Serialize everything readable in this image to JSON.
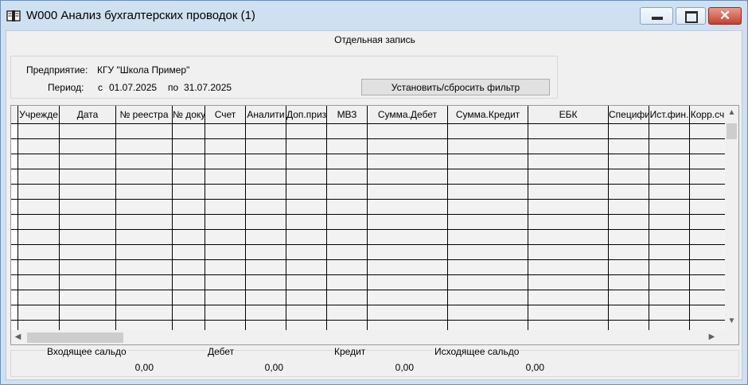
{
  "window": {
    "title": "W000 Анализ бухгалтерских проводок (1)",
    "accent": "#cfe0f1",
    "close_color": "#c7402b",
    "icons": {
      "app": "ledger-book-icon",
      "minimize": "minimize-icon",
      "maximize": "maximize-icon",
      "close": "close-icon"
    }
  },
  "heading": "Отдельная запись",
  "info": {
    "enterprise_label": "Предприятие:",
    "enterprise_value": "КГУ \"Школа Пример\"",
    "period_label": "Период:",
    "from_prefix": "с",
    "date_from": "01.07.2025",
    "to_prefix": "по",
    "date_to": "31.07.2025",
    "filter_button": "Установить/сбросить фильтр"
  },
  "grid": {
    "columns": [
      "Учрежде",
      "Дата",
      "№ реестра",
      "№ доку",
      "Счет",
      "Аналити",
      "Доп.приз",
      "МВЗ",
      "Сумма.Дебет",
      "Сумма.Кредит",
      "ЕБК",
      "Специфи",
      "Ист.фин.",
      "Корр.сч"
    ],
    "rows": 13,
    "scroll_icons": {
      "up": "scroll-up-icon",
      "down": "scroll-down-icon",
      "left": "scroll-left-icon",
      "right": "scroll-right-icon"
    }
  },
  "totals": {
    "incoming_label": "Входящее сальдо",
    "incoming_value": "0,00",
    "debit_label": "Дебет",
    "debit_value": "0,00",
    "credit_label": "Кредит",
    "credit_value": "0,00",
    "outgoing_label": "Исходящее сальдо",
    "outgoing_value": "0,00"
  }
}
